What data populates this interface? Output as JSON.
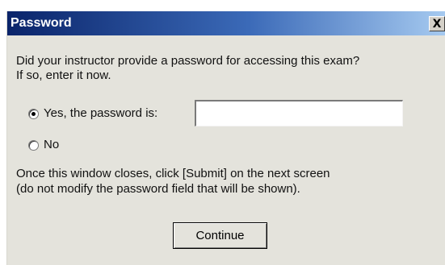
{
  "window": {
    "title": "Password",
    "close_label": "X"
  },
  "prompt": {
    "line1": "Did your instructor provide a password for accessing this exam?",
    "line2": "If so, enter it now."
  },
  "options": {
    "yes_label": "Yes, the password is:",
    "yes_selected": true,
    "no_label": "No",
    "no_selected": false
  },
  "password_field": {
    "value": "",
    "placeholder": ""
  },
  "note": {
    "line1": "Once this window closes, click [Submit] on the next screen",
    "line2": "(do not modify the password field that will be shown)."
  },
  "buttons": {
    "continue_label": "Continue"
  }
}
